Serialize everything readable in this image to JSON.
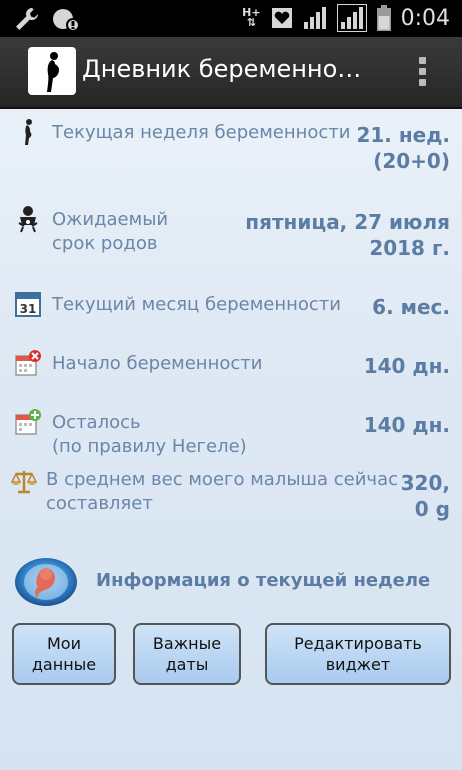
{
  "status_bar": {
    "time": "0:04",
    "network": "H+"
  },
  "app_bar": {
    "title": "Дневник беременности"
  },
  "rows": [
    {
      "label": "Текущая неделя беременности",
      "value": "21. нед.\n(20+0)"
    },
    {
      "label": "Ожидаемый\nсрок родов",
      "value": "пятница, 27 июля\n2018 г."
    },
    {
      "label": "Текущий месяц беременности",
      "value": "6. мес."
    },
    {
      "label": "Начало беременности",
      "value": "140 дн."
    },
    {
      "label": "Осталось\n(по правилу Негеле)",
      "value": "140 дн."
    },
    {
      "label": "В среднем вес моего малыша сейчас\nсоставляет",
      "value": "320,\n0 g"
    }
  ],
  "calendar_icon_number": "31",
  "info": {
    "label": "Информация о текущей неделе"
  },
  "buttons": {
    "my_data": "Мои\nданные",
    "important_dates": "Важные\nдаты",
    "edit_widget": "Редактировать\nвиджет"
  }
}
